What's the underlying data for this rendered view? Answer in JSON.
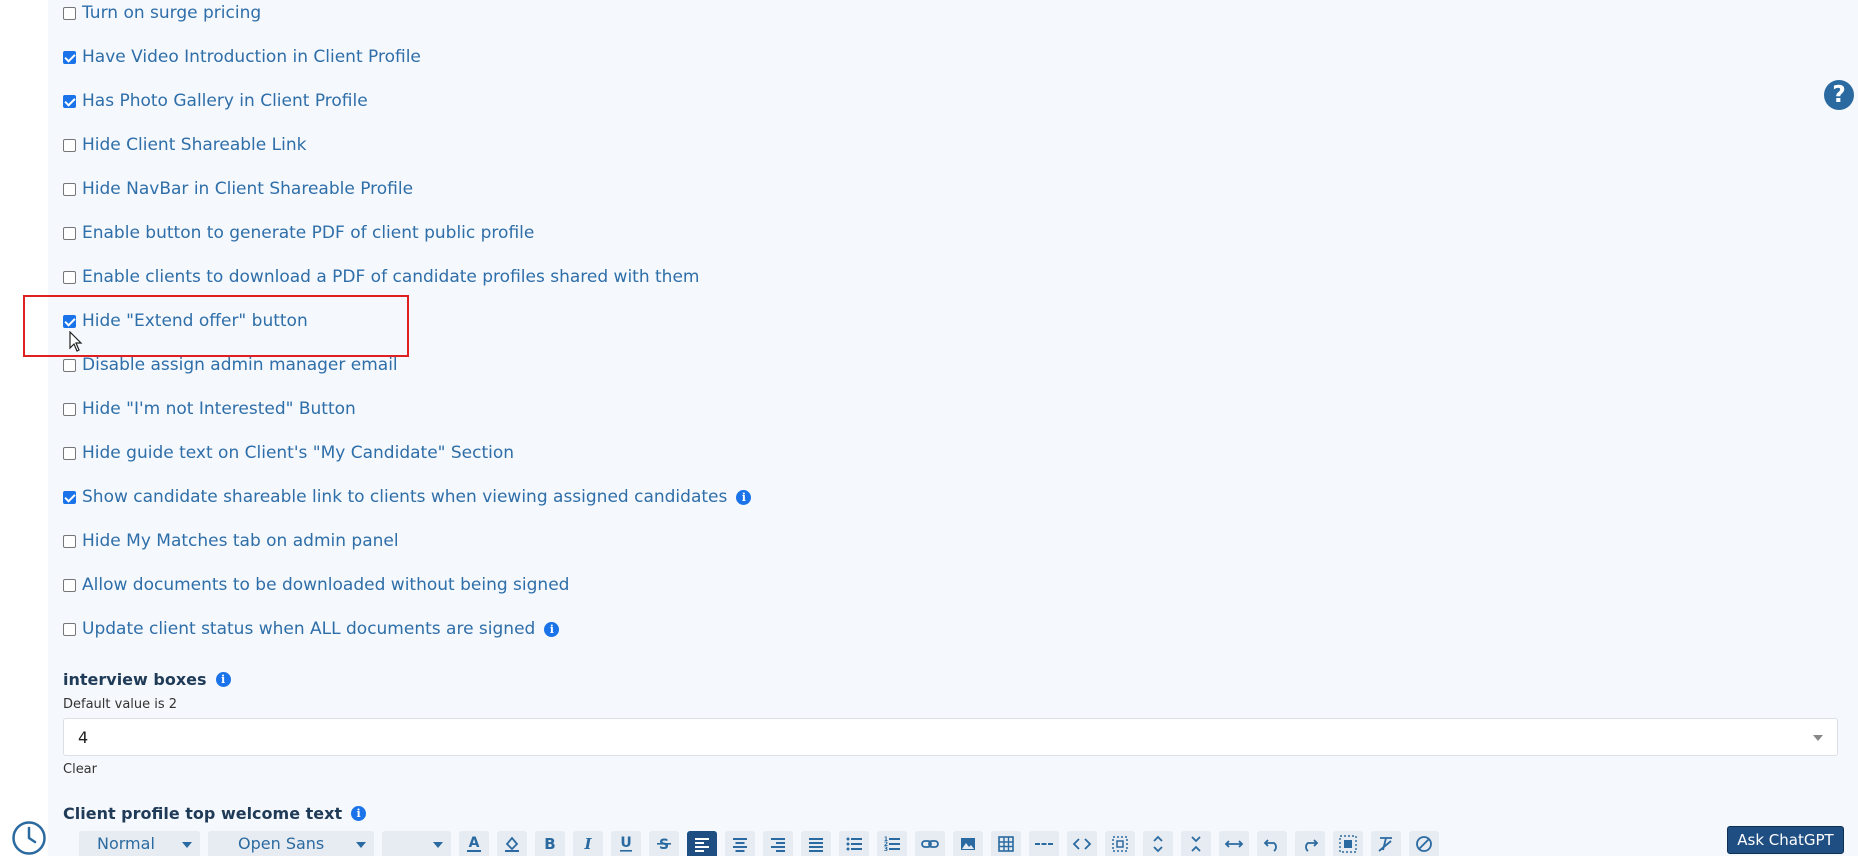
{
  "options": [
    {
      "label": "Turn on surge pricing",
      "checked": false,
      "info": false
    },
    {
      "label": "Have Video Introduction in Client Profile",
      "checked": true,
      "info": false
    },
    {
      "label": "Has Photo Gallery in Client Profile",
      "checked": true,
      "info": false
    },
    {
      "label": "Hide Client Shareable Link",
      "checked": false,
      "info": false
    },
    {
      "label": "Hide NavBar in Client Shareable Profile",
      "checked": false,
      "info": false
    },
    {
      "label": "Enable button to generate PDF of client public profile",
      "checked": false,
      "info": false
    },
    {
      "label": "Enable clients to download a PDF of candidate profiles shared with them",
      "checked": false,
      "info": false
    },
    {
      "label": "Hide \"Extend offer\" button",
      "checked": true,
      "info": false
    },
    {
      "label": "Disable assign admin manager email",
      "checked": false,
      "info": false
    },
    {
      "label": "Hide \"I'm not Interested\" Button",
      "checked": false,
      "info": false
    },
    {
      "label": "Hide guide text on Client's \"My Candidate\" Section",
      "checked": false,
      "info": false
    },
    {
      "label": "Show candidate shareable link to clients when viewing assigned candidates",
      "checked": true,
      "info": true
    },
    {
      "label": "Hide My Matches tab on admin panel",
      "checked": false,
      "info": false
    },
    {
      "label": "Allow documents to be downloaded without being signed",
      "checked": false,
      "info": false
    },
    {
      "label": "Update client status when ALL documents are signed",
      "checked": false,
      "info": true
    }
  ],
  "interview_boxes": {
    "title": "interview boxes",
    "hint": "Default value is 2",
    "value": "4",
    "clear_label": "Clear"
  },
  "welcome_text": {
    "title": "Client profile top welcome text"
  },
  "help_icon": "?",
  "info_glyph": "i",
  "editor_toolbar": {
    "style_value": "Normal",
    "font_value": "Open Sans",
    "size_value": "",
    "buttons": [
      "font-color",
      "background-color",
      "bold",
      "italic",
      "underline",
      "strikethrough",
      "align-left",
      "align-center",
      "align-right",
      "align-justify",
      "bullet-list",
      "numbered-list",
      "link",
      "image",
      "table",
      "horizontal-rule",
      "code-view",
      "select-all",
      "expand-up",
      "collapse",
      "fullwidth",
      "undo",
      "redo",
      "show-blocks",
      "clear-format",
      "remove"
    ],
    "active_button": "align-left"
  },
  "ask_chatgpt_label": "Ask ChatGPT",
  "colors": {
    "label_blue": "#2e6ea9",
    "checkbox_blue": "#1a73e8",
    "highlight_red": "#e02020",
    "dark_navy": "#1f4f82"
  }
}
